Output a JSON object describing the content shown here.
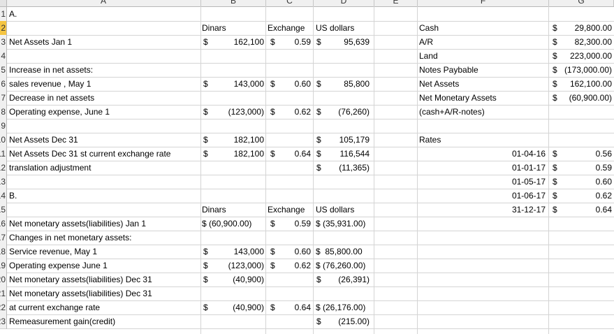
{
  "columns": [
    "A",
    "B",
    "C",
    "D",
    "E",
    "F",
    "G"
  ],
  "rows": [
    {
      "n": "1",
      "cells": {
        "A": "A."
      }
    },
    {
      "n": "2",
      "sel": true,
      "cells": {
        "B": "Dinars",
        "C": "Exchange",
        "D": "US dollars",
        "F": "Cash",
        "G1": "$",
        "G2": "29,800.00"
      }
    },
    {
      "n": "3",
      "cells": {
        "A": "Net Assets Jan 1",
        "B1": "$",
        "B2": "162,100",
        "C1": "$",
        "C2": "0.59",
        "D1": "$",
        "D2": "95,639",
        "F": "A/R",
        "G1": "$",
        "G2": "82,300.00"
      }
    },
    {
      "n": "4",
      "cells": {
        "F": "Land",
        "G1": "$",
        "G2": "223,000.00"
      }
    },
    {
      "n": "5",
      "cells": {
        "A": "Increase in net assets:",
        "F": "Notes Paybable",
        "G1": "$",
        "G2": "(173,000.00)"
      }
    },
    {
      "n": "6",
      "cells": {
        "A": "sales revenue , May 1",
        "B1": "$",
        "B2": "143,000",
        "C1": "$",
        "C2": "0.60",
        "D1": "$",
        "D2": "85,800",
        "F": "Net Assets",
        "G1": "$",
        "G2": "162,100.00"
      }
    },
    {
      "n": "7",
      "cells": {
        "A": "Decrease in net assets",
        "F": "Net Monetary Assets",
        "G1": "$",
        "G2": "(60,900.00)"
      }
    },
    {
      "n": "8",
      "cells": {
        "A": "Operating expense, June 1",
        "B1": "$",
        "B2": "(123,000)",
        "C1": "$",
        "C2": "0.62",
        "D1": "$",
        "D2": "(76,260)",
        "F": "(cash+A/R-notes)"
      }
    },
    {
      "n": "9",
      "cells": {}
    },
    {
      "n": "10",
      "cells": {
        "A": "Net Assets Dec 31",
        "B1": "$",
        "B2": "182,100",
        "D1": "$",
        "D2": "105,179",
        "F": "Rates"
      }
    },
    {
      "n": "11",
      "cells": {
        "A": "Net Assets Dec 31 st current exchange rate",
        "B1": "$",
        "B2": "182,100",
        "C1": "$",
        "C2": "0.64",
        "D1": "$",
        "D2": "116,544",
        "F2": "01-04-16",
        "G1": "$",
        "G2": "0.56"
      }
    },
    {
      "n": "12",
      "cells": {
        "A": "translation adjustment",
        "D1": "$",
        "D2": "(11,365)",
        "F2": "01-01-17",
        "G1": "$",
        "G2": "0.59"
      }
    },
    {
      "n": "13",
      "cells": {
        "F2": "01-05-17",
        "G1": "$",
        "G2": "0.60"
      }
    },
    {
      "n": "14",
      "cells": {
        "A": "B.",
        "F2": "01-06-17",
        "G1": "$",
        "G2": "0.62"
      }
    },
    {
      "n": "15",
      "cells": {
        "B": "Dinars",
        "C": "Exchange",
        "D": "US dollars",
        "F2": "31-12-17",
        "G1": "$",
        "G2": "0.64"
      }
    },
    {
      "n": "16",
      "cells": {
        "A": "Net monetary assets(liabilities) Jan 1",
        "B": "$ (60,900.00)",
        "C1": "$",
        "C2": "0.59",
        "D": "$ (35,931.00)"
      }
    },
    {
      "n": "17",
      "cells": {
        "A": "Changes in net monetary assets:"
      }
    },
    {
      "n": "18",
      "cells": {
        "A": "Service revenue, May 1",
        "B1": "$",
        "B2": "143,000",
        "C1": "$",
        "C2": "0.60",
        "D": "$  85,800.00"
      }
    },
    {
      "n": "19",
      "cells": {
        "A": "Operating expense June 1",
        "B1": "$",
        "B2": "(123,000)",
        "C1": "$",
        "C2": "0.62",
        "D": "$ (76,260.00)"
      }
    },
    {
      "n": "20",
      "cells": {
        "A": "Net monetary assets(liabilities) Dec 31",
        "B1": "$",
        "B2": "(40,900)",
        "D1": "$",
        "D2": "(26,391)"
      }
    },
    {
      "n": "21",
      "cells": {
        "A": "Net monetary assets(liabilities) Dec 31"
      }
    },
    {
      "n": "22",
      "cells": {
        "A": "at current exchange rate",
        "B1": "$",
        "B2": "(40,900)",
        "C1": "$",
        "C2": "0.64",
        "D": "$ (26,176.00)"
      }
    },
    {
      "n": "23",
      "cells": {
        "A": "Remeasurement gain(credit)",
        "D1": "$",
        "D2": "(215.00)"
      }
    }
  ]
}
